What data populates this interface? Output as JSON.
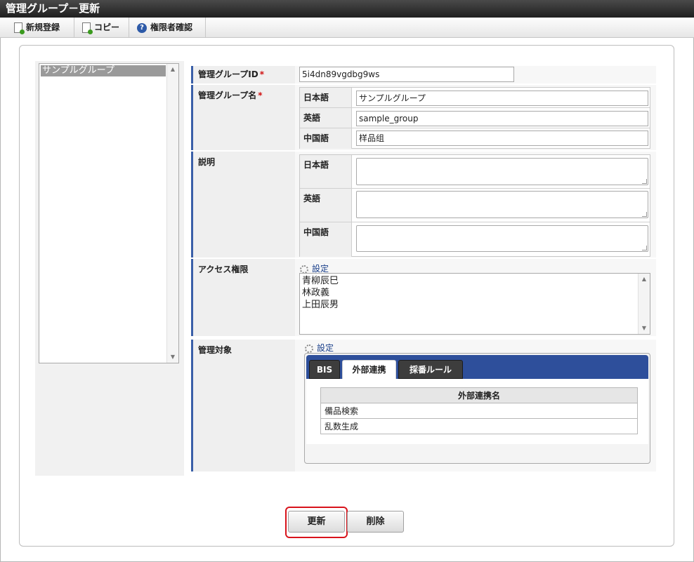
{
  "title": "管理グループ－更新",
  "toolbar": {
    "new_label": "新規登録",
    "copy_label": "コピー",
    "auth_label": "権限者確認"
  },
  "group_list": {
    "selected": "サンプルグループ"
  },
  "form": {
    "id_label": "管理グループID",
    "id_value": "5i4dn89vgdbg9ws",
    "name_label": "管理グループ名",
    "required_mark": "*",
    "lang_ja": "日本語",
    "lang_en": "英語",
    "lang_zh": "中国語",
    "name_ja": "サンプルグループ",
    "name_en": "sample_group",
    "name_zh": "样品组",
    "desc_label": "説明",
    "access_label": "アクセス権限",
    "setting_link": "設定",
    "access_users": [
      "青柳辰巳",
      "林政義",
      "上田辰男"
    ],
    "target_label": "管理対象"
  },
  "tabs": [
    {
      "label": "BIS",
      "active": false
    },
    {
      "label": "外部連携",
      "active": true
    },
    {
      "label": "採番ルール",
      "active": false
    }
  ],
  "target_table": {
    "header": "外部連携名",
    "rows": [
      "備品検索",
      "乱数生成"
    ]
  },
  "buttons": {
    "update": "更新",
    "delete": "削除"
  },
  "colors": {
    "accent": "#2e4f9b",
    "focus": "#d8131b",
    "required": "#d01010"
  }
}
